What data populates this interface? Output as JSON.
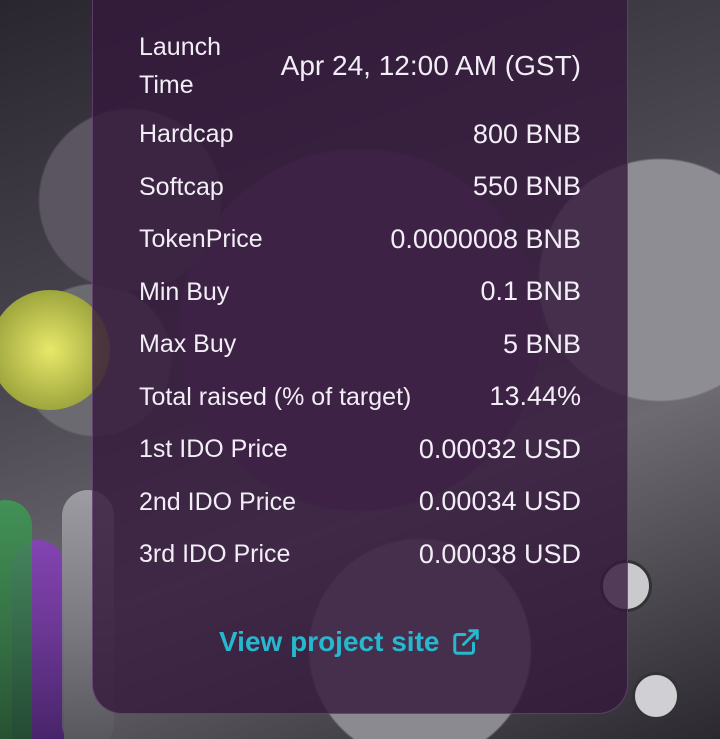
{
  "details": [
    {
      "label": "Launch Time",
      "value": "Apr 24, 12:00 AM (GST)"
    },
    {
      "label": "Hardcap",
      "value": "800 BNB"
    },
    {
      "label": "Softcap",
      "value": "550 BNB"
    },
    {
      "label": "TokenPrice",
      "value": "0.0000008 BNB"
    },
    {
      "label": "Min Buy",
      "value": "0.1 BNB"
    },
    {
      "label": "Max Buy",
      "value": "5 BNB"
    },
    {
      "label": "Total raised (% of target)",
      "value": "13.44%"
    },
    {
      "label": "1st IDO Price",
      "value": "0.00032 USD"
    },
    {
      "label": "2nd IDO Price",
      "value": "0.00034 USD"
    },
    {
      "label": "3rd IDO Price",
      "value": "0.00038 USD"
    }
  ],
  "project_link": {
    "label": "View project site",
    "icon": "external-link-icon",
    "color": "#26b8cf"
  },
  "card_background": "#34183c"
}
